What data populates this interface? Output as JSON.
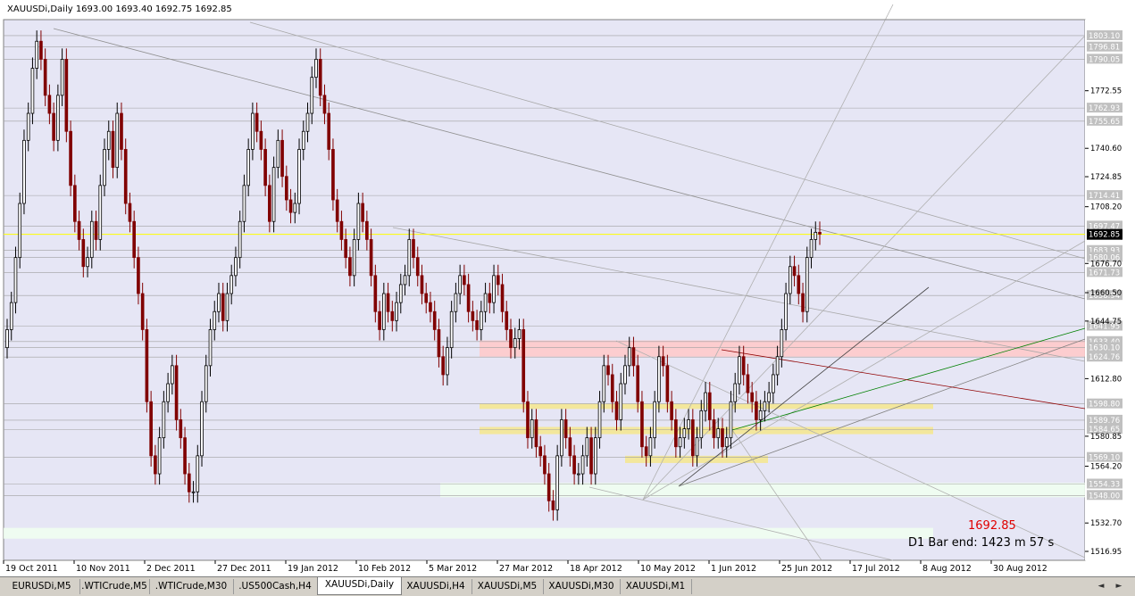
{
  "header": {
    "text": "XAUUSDi,Daily  1693.00 1693.40 1692.75 1692.85"
  },
  "status": {
    "price": "1692.85",
    "bar_end": "D1 Bar end: 1423 m 57 s"
  },
  "tabs": [
    {
      "label": "EURUSDi,M5"
    },
    {
      "label": ".WTICrude,M5"
    },
    {
      "label": ".WTICrude,M30"
    },
    {
      "label": ".US500Cash,H4"
    },
    {
      "label": "XAUUSDi,Daily"
    },
    {
      "label": "XAUUSDi,H4"
    },
    {
      "label": "XAUUSDi,M5"
    },
    {
      "label": "XAUUSDi,M30"
    },
    {
      "label": "XAUUSDi,M1"
    }
  ],
  "active_tab": 4,
  "tab_scroll": {
    "left": "◄",
    "right": "►"
  },
  "colors": {
    "background": "#e6e6f5",
    "bull": "#000000",
    "bear": "#800000",
    "grid_line": "#a0a0a0",
    "current_price_line": "#ffff00",
    "pink_zone": "#ffc8c8",
    "yellow_zone": "#f5e68c",
    "green_zone": "#f0fff0"
  },
  "chart_data": {
    "type": "candlestick",
    "symbol": "XAUUSDi",
    "timeframe": "Daily",
    "ohlc": {
      "open": 1693.0,
      "high": 1693.4,
      "low": 1692.75,
      "close": 1692.85
    },
    "ylim": [
      1512,
      1812
    ],
    "y_ticks": [
      "1772.55",
      "1740.60",
      "1724.85",
      "1708.20",
      "1676.70",
      "1660.50",
      "1644.75",
      "1612.80",
      "1580.85",
      "1564.20",
      "1532.70",
      "1516.95"
    ],
    "y_ticks_values": [
      1772.55,
      1740.6,
      1724.85,
      1708.2,
      1676.7,
      1660.5,
      1644.75,
      1612.8,
      1580.85,
      1564.2,
      1532.7,
      1516.95
    ],
    "level_labels": [
      "1803.10",
      "1796.81",
      "1790.05",
      "1762.93",
      "1755.65",
      "1714.41",
      "1697.47",
      "1683.93",
      "1680.06",
      "1671.73",
      "1658.94",
      "1641.95",
      "1633.40",
      "1630.10",
      "1624.76",
      "1598.80",
      "1589.76",
      "1584.65",
      "1569.10",
      "1554.33",
      "1548.00"
    ],
    "level_values": [
      1803.1,
      1796.81,
      1790.05,
      1762.93,
      1755.65,
      1714.41,
      1697.47,
      1683.93,
      1680.06,
      1671.73,
      1658.94,
      1641.95,
      1633.4,
      1630.1,
      1624.76,
      1598.8,
      1589.76,
      1584.65,
      1569.1,
      1554.33,
      1548.0
    ],
    "current_price_label": "1692.85",
    "current_price": 1692.85,
    "x_labels": [
      "19 Oct 2011",
      "10 Nov 2011",
      "2 Dec 2011",
      "27 Dec 2011",
      "19 Jan 2012",
      "10 Feb 2012",
      "5 Mar 2012",
      "27 Mar 2012",
      "18 Apr 2012",
      "10 May 2012",
      "1 Jun 2012",
      "25 Jun 2012",
      "17 Jul 2012",
      "8 Aug 2012",
      "30 Aug 2012"
    ],
    "zones": [
      {
        "type": "pink",
        "from": 1625,
        "to": 1634,
        "start": "18 Apr 2012",
        "end": "right-edge"
      },
      {
        "type": "yellow",
        "from": 1596,
        "to": 1599,
        "start": "18 Apr 2012",
        "end": "30 Aug 2012"
      },
      {
        "type": "yellow",
        "from": 1582,
        "to": 1586,
        "start": "18 Apr 2012",
        "end": "30 Aug 2012"
      },
      {
        "type": "yellow",
        "from": 1566,
        "to": 1570,
        "start": "25 Jun 2012",
        "end": "8 Aug 2012"
      },
      {
        "type": "green",
        "from": 1547,
        "to": 1555,
        "start": "10 May 2012",
        "end": "right-edge"
      },
      {
        "type": "green",
        "from": 1524,
        "to": 1530,
        "start": "19 Oct 2011",
        "end": "30 Aug 2012"
      }
    ],
    "close_series": [
      1640,
      1655,
      1680,
      1710,
      1745,
      1760,
      1785,
      1800,
      1790,
      1770,
      1760,
      1745,
      1770,
      1790,
      1750,
      1720,
      1700,
      1690,
      1675,
      1680,
      1700,
      1690,
      1720,
      1740,
      1750,
      1730,
      1760,
      1740,
      1710,
      1700,
      1680,
      1660,
      1640,
      1600,
      1570,
      1560,
      1580,
      1600,
      1610,
      1620,
      1590,
      1580,
      1560,
      1550,
      1550,
      1570,
      1600,
      1620,
      1640,
      1650,
      1660,
      1645,
      1660,
      1670,
      1680,
      1700,
      1720,
      1740,
      1760,
      1750,
      1740,
      1720,
      1700,
      1730,
      1745,
      1725,
      1712,
      1705,
      1710,
      1740,
      1750,
      1760,
      1780,
      1790,
      1770,
      1760,
      1740,
      1712,
      1700,
      1690,
      1680,
      1670,
      1690,
      1710,
      1700,
      1690,
      1670,
      1650,
      1640,
      1660,
      1650,
      1645,
      1655,
      1665,
      1670,
      1690,
      1680,
      1670,
      1660,
      1655,
      1650,
      1640,
      1625,
      1615,
      1630,
      1650,
      1660,
      1670,
      1665,
      1650,
      1645,
      1640,
      1650,
      1660,
      1655,
      1670,
      1665,
      1650,
      1640,
      1630,
      1635,
      1640,
      1600,
      1580,
      1590,
      1575,
      1570,
      1560,
      1545,
      1540,
      1570,
      1590,
      1580,
      1570,
      1560,
      1560,
      1570,
      1580,
      1560,
      1580,
      1600,
      1620,
      1615,
      1600,
      1590,
      1610,
      1620,
      1630,
      1620,
      1600,
      1575,
      1570,
      1580,
      1600,
      1625,
      1620,
      1600,
      1590,
      1575,
      1580,
      1585,
      1590,
      1570,
      1580,
      1595,
      1605,
      1590,
      1580,
      1585,
      1575,
      1580,
      1600,
      1610,
      1625,
      1615,
      1605,
      1600,
      1590,
      1595,
      1600,
      1605,
      1615,
      1625,
      1640,
      1660,
      1675,
      1670,
      1660,
      1650,
      1680,
      1690,
      1694,
      1693
    ]
  }
}
